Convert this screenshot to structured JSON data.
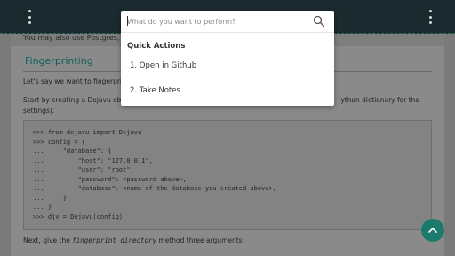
{
  "page": {
    "top_partial_text": "You may also use Postgres, ...",
    "section_title": "Fingerprinting",
    "paragraph1": "Let's say we want to fingerprint ...",
    "paragraph2_start": "Start by creating a Dejavu obj",
    "paragraph2_end": "ython dictionary for the",
    "paragraph2_line2": "settings).",
    "code_lines": [
      ">>> from dejavu import Dejavu",
      ">>> config = {",
      "...     \"database\": {",
      "...         \"host\": \"127.0.0.1\",",
      "...         \"user\": \"root\",",
      "...         \"password\": <password above>,",
      "...         \"database\": <name of the database you created above>,",
      "...     }",
      "... }",
      ">>> djv = Dejavu(config)"
    ],
    "paragraph3_prefix": "Next, give the ",
    "paragraph3_code": "fingerprint_directory",
    "paragraph3_suffix": " method three arguments:"
  },
  "search": {
    "placeholder": "What do you want to perform?",
    "value": ""
  },
  "quick_actions": {
    "title": "Quick Actions",
    "items": [
      {
        "label": "1. Open in Github"
      },
      {
        "label": "2. Take Notes"
      }
    ]
  },
  "icons": {
    "menu_left": "more-vertical-icon",
    "menu_right": "more-vertical-icon",
    "search": "search-icon",
    "scroll_top": "chevron-up-icon"
  },
  "colors": {
    "accent": "#1c7a6c",
    "topbar": "#1b2a2e",
    "section_title": "#0e5f56"
  }
}
